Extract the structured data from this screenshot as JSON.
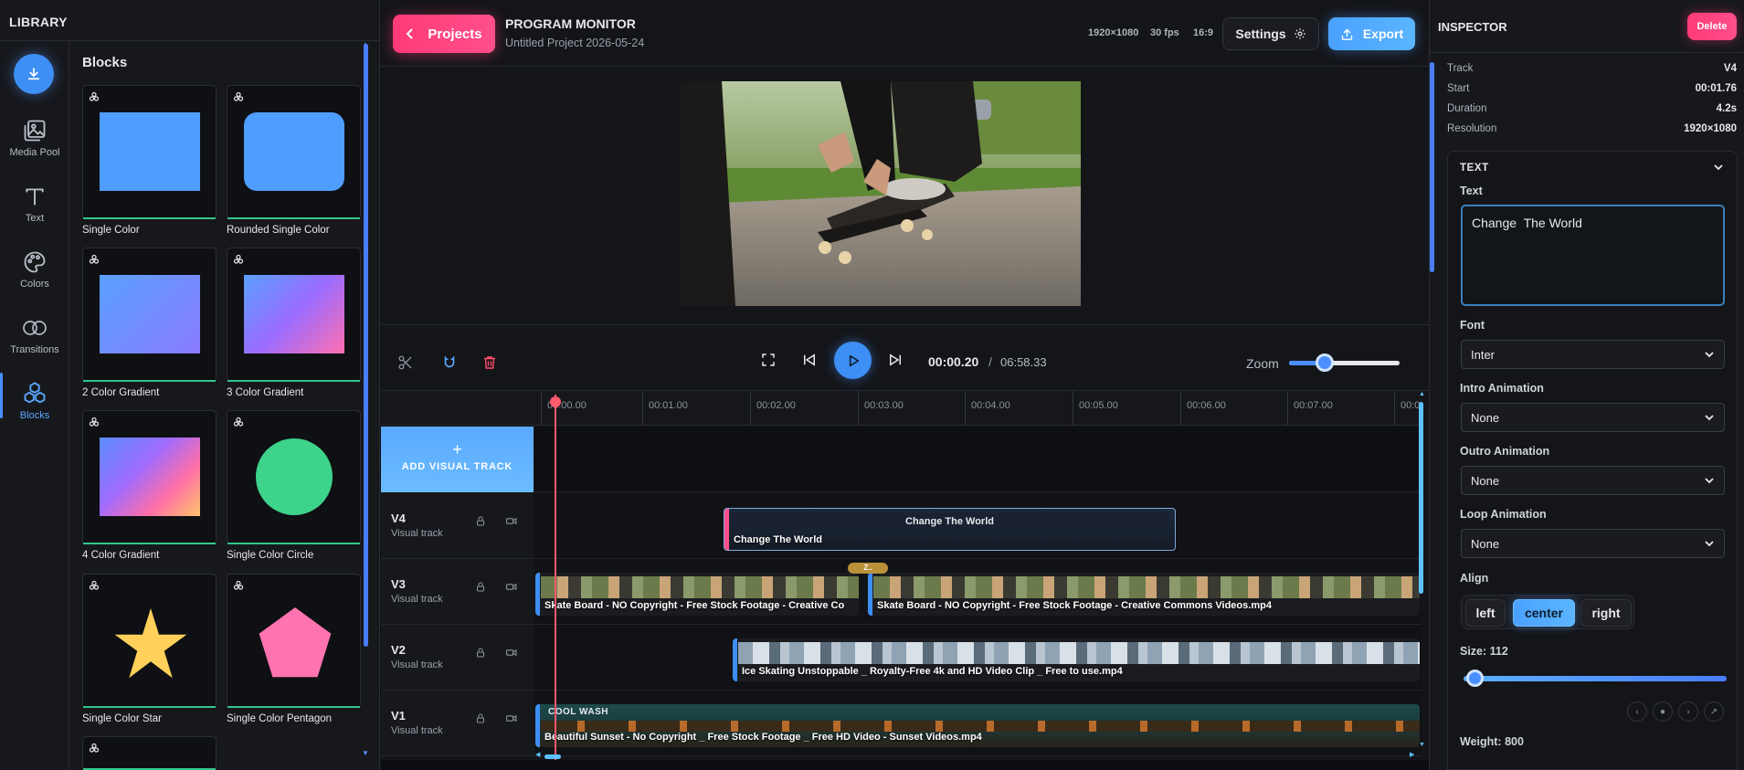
{
  "library": {
    "title": "LIBRARY",
    "rail": [
      {
        "label": "Media Pool",
        "icon": "media-pool-icon"
      },
      {
        "label": "Text",
        "icon": "text-icon"
      },
      {
        "label": "Colors",
        "icon": "palette-icon"
      },
      {
        "label": "Transitions",
        "icon": "transitions-icon"
      },
      {
        "label": "Blocks",
        "icon": "blocks-icon",
        "active": true
      }
    ],
    "blocks_title": "Blocks",
    "blocks": [
      {
        "label": "Single Color"
      },
      {
        "label": "Rounded Single Color"
      },
      {
        "label": "2 Color Gradient"
      },
      {
        "label": "3 Color Gradient"
      },
      {
        "label": "4 Color Gradient"
      },
      {
        "label": "Single Color Circle"
      },
      {
        "label": "Single Color Star"
      },
      {
        "label": "Single Color Pentagon"
      }
    ]
  },
  "header": {
    "projects_label": "Projects",
    "title": "PROGRAM MONITOR",
    "subtitle": "Untitled Project 2026-05-24",
    "resolution": "1920×1080",
    "fps": "30 fps",
    "aspect": "16:9",
    "settings_label": "Settings",
    "export_label": "Export"
  },
  "transport": {
    "current_time": "00:00.20",
    "separator": "/",
    "total_time": "06:58.33",
    "zoom_label": "Zoom",
    "zoom_level": 0.27
  },
  "timeline": {
    "ticks": [
      "00:00.00",
      "00:01.00",
      "00:02.00",
      "00:03.00",
      "00:04.00",
      "00:05.00",
      "00:06.00",
      "00:07.00",
      "00:0"
    ],
    "add_track_plus": "+",
    "add_track_label": "ADD VISUAL TRACK",
    "tracks": [
      {
        "name": "V4",
        "subtitle": "Visual track"
      },
      {
        "name": "V3",
        "subtitle": "Visual track"
      },
      {
        "name": "V2",
        "subtitle": "Visual track"
      },
      {
        "name": "V1",
        "subtitle": "Visual track"
      }
    ],
    "clips": {
      "v4_title": "Change The World",
      "v4_name": "Change The World",
      "v3_a": "Skate Board - NO Copyright - Free Stock Footage - Creative Co",
      "v3_b": "Skate Board - NO Copyright - Free Stock Footage - Creative Commons Videos.mp4",
      "v3_badge": "Z..",
      "v2": "Ice Skating Unstoppable _ Royalty-Free 4k and HD Video Clip _ Free to use.mp4",
      "v1_effect": "COOL WASH",
      "v1": "Beautiful Sunset - No Copyright _ Free Stock Footage _ Free HD Video - Sunset Videos.mp4"
    }
  },
  "inspector": {
    "title": "INSPECTOR",
    "delete_label": "Delete",
    "props": [
      {
        "key": "Track",
        "value": "V4"
      },
      {
        "key": "Start",
        "value": "00:01.76"
      },
      {
        "key": "Duration",
        "value": "4.2s"
      },
      {
        "key": "Resolution",
        "value": "1920×1080"
      }
    ],
    "section_title": "TEXT",
    "text_label": "Text",
    "text_value": "Change  The World",
    "font_label": "Font",
    "font_value": "Inter",
    "intro_label": "Intro Animation",
    "intro_value": "None",
    "outro_label": "Outro Animation",
    "outro_value": "None",
    "loop_label": "Loop Animation",
    "loop_value": "None",
    "align_label": "Align",
    "align_options": [
      "left",
      "center",
      "right"
    ],
    "align_selected": "center",
    "size_label": "Size: 112",
    "weight_label": "Weight: 800"
  },
  "colors": {
    "accent_blue": "#3d8ef5",
    "accent_pink": "#ff3b78",
    "block_blue": "#4f9dff",
    "block_green": "#3dd38a",
    "block_yellow": "#ffd05a",
    "block_pink": "#ff74b0"
  }
}
